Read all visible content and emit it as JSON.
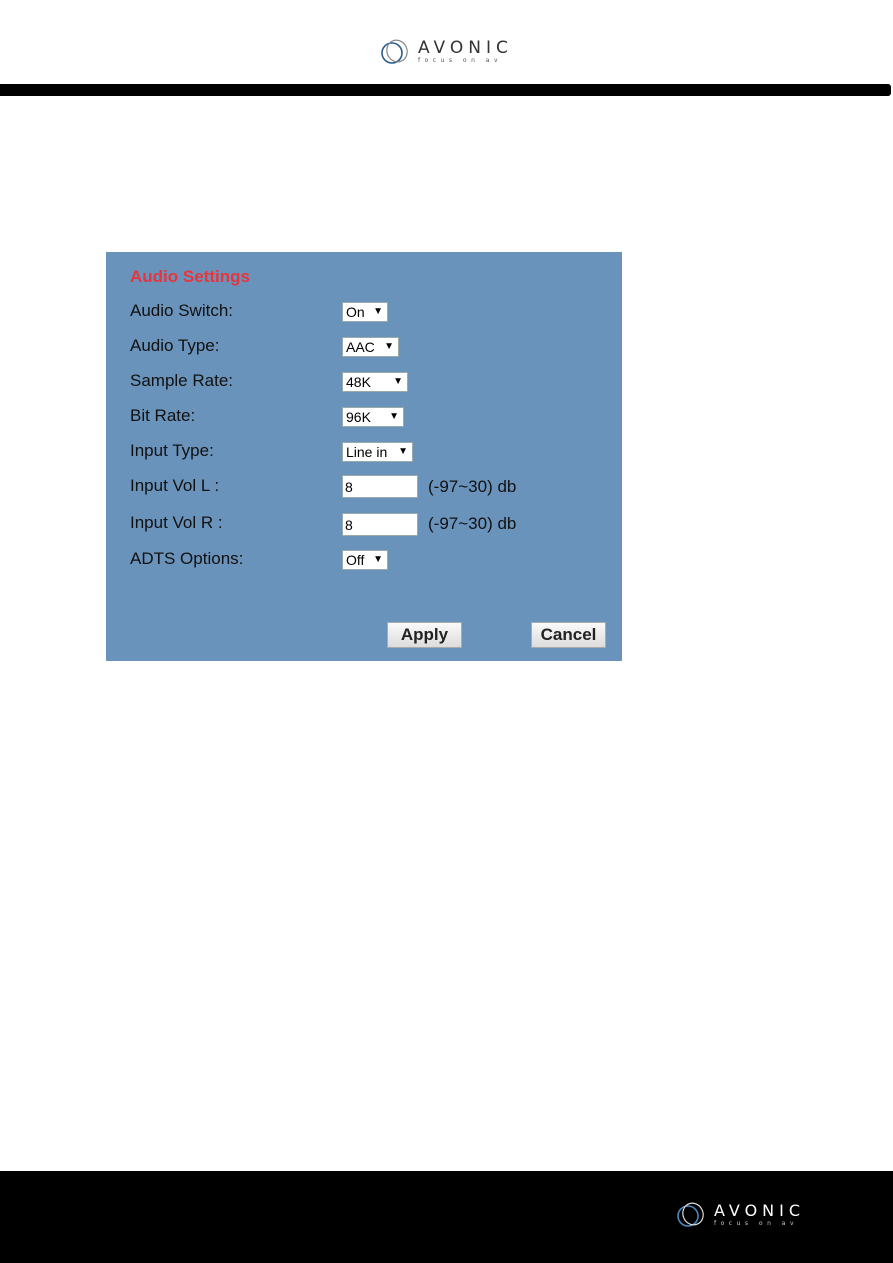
{
  "brand": {
    "name": "AVONIC",
    "tagline": "focus on av"
  },
  "panel": {
    "title": "Audio Settings",
    "fields": [
      {
        "label": "Audio Switch:",
        "type": "select",
        "value": "On"
      },
      {
        "label": "Audio Type:",
        "type": "select",
        "value": "AAC"
      },
      {
        "label": "Sample Rate:",
        "type": "select",
        "value": "48K"
      },
      {
        "label": "Bit Rate:",
        "type": "select",
        "value": "96K"
      },
      {
        "label": "Input Type:",
        "type": "select",
        "value": "Line in"
      },
      {
        "label": "Input Vol L :",
        "type": "input",
        "value": "8",
        "hint": "(-97~30) db"
      },
      {
        "label": "Input Vol R :",
        "type": "input",
        "value": "8",
        "hint": "(-97~30) db"
      },
      {
        "label": "ADTS Options:",
        "type": "select",
        "value": "Off"
      }
    ],
    "apply_label": "Apply",
    "cancel_label": "Cancel"
  },
  "colors": {
    "panel_bg": "#6a93bb",
    "title": "#e8343c"
  }
}
